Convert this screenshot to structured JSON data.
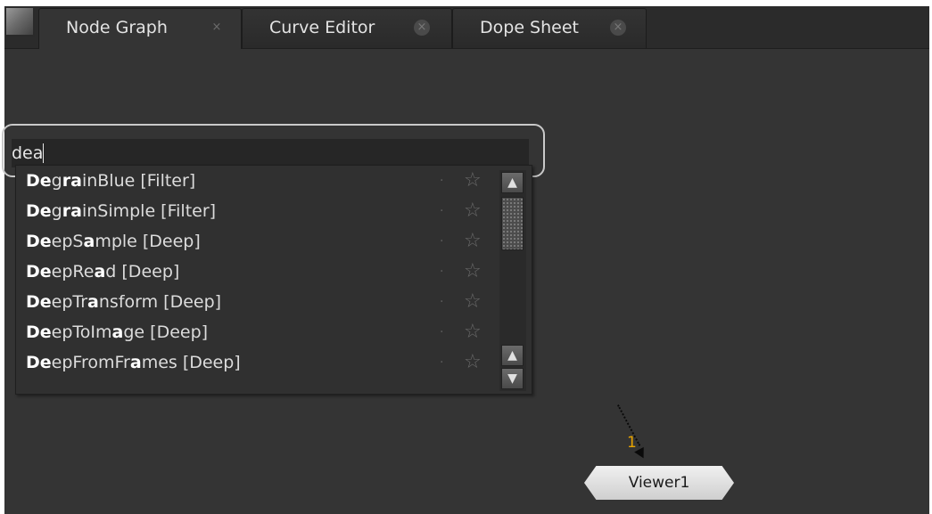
{
  "tabs": [
    {
      "label": "Node Graph",
      "close": "×",
      "active": true
    },
    {
      "label": "Curve Editor",
      "close": "×",
      "active": false
    },
    {
      "label": "Dope Sheet",
      "close": "×",
      "active": false
    }
  ],
  "search": {
    "value": "dea"
  },
  "results": [
    {
      "segments": [
        [
          "De",
          true
        ],
        [
          "g",
          false
        ],
        [
          "ra",
          true
        ],
        [
          "inBlue [Filter]",
          false
        ]
      ]
    },
    {
      "segments": [
        [
          "De",
          true
        ],
        [
          "g",
          false
        ],
        [
          "ra",
          true
        ],
        [
          "inSimple [Filter]",
          false
        ]
      ]
    },
    {
      "segments": [
        [
          "De",
          true
        ],
        [
          "epS",
          false
        ],
        [
          "a",
          true
        ],
        [
          "mple [Deep]",
          false
        ]
      ]
    },
    {
      "segments": [
        [
          "De",
          true
        ],
        [
          "epRe",
          false
        ],
        [
          "a",
          true
        ],
        [
          "d [Deep]",
          false
        ]
      ]
    },
    {
      "segments": [
        [
          "De",
          true
        ],
        [
          "epTr",
          false
        ],
        [
          "a",
          true
        ],
        [
          "nsform [Deep]",
          false
        ]
      ]
    },
    {
      "segments": [
        [
          "De",
          true
        ],
        [
          "epToIm",
          false
        ],
        [
          "a",
          true
        ],
        [
          "ge [Deep]",
          false
        ]
      ]
    },
    {
      "segments": [
        [
          "De",
          true
        ],
        [
          "epFromFr",
          false
        ],
        [
          "a",
          true
        ],
        [
          "mes [Deep]",
          false
        ]
      ]
    }
  ],
  "result_icons": {
    "dot": "·",
    "star": "☆"
  },
  "scroll": {
    "up": "▲",
    "down": "▼"
  },
  "graph": {
    "edge_label": "1",
    "node_label": "Viewer1"
  }
}
